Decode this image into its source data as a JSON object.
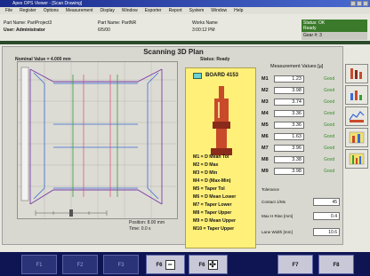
{
  "window": {
    "title": "Apex OPS Viewer - [Scan Drawing]"
  },
  "menu": [
    "File",
    "Register",
    "Options",
    "Measurement",
    "Display",
    "Window",
    "Exporter",
    "Report",
    "System",
    "Window",
    "Help"
  ],
  "info": {
    "r1c1": "Part Name: PartProject3",
    "r1c2": "Part Name: PartNR",
    "r1c3": "Works Name",
    "r2c1": "User: Administrator",
    "r2c2": "6/5/00",
    "r2c3": "3:00:12 PM"
  },
  "status": {
    "top": "Status: OK",
    "sub": "Ready",
    "bottom": "Gear #: 3"
  },
  "panel": {
    "title": "Scanning 3D Plan",
    "meter_left": "Nominal Value = 4.000 mm",
    "meter_right": "Status: Ready",
    "position": "Position: 8.00 mm",
    "time": "Time: 0.0 s"
  },
  "probe": {
    "label": "BOARD 4153",
    "legend": [
      "M1 = D Mean Tol",
      "M2 = D Max",
      "M3 = D Min",
      "M4 = D (Max-Min)",
      "M5 = Taper Tol",
      "M6 = D Mean Lower",
      "M7 = Taper Lower",
      "M8 = Taper Upper",
      "M9 = D Mean Upper",
      "M10 = Taper Upper"
    ]
  },
  "measurement": {
    "title": "Measurement Values [µ]",
    "rows": [
      {
        "key": "M1",
        "value": "1.23",
        "status": "Good"
      },
      {
        "key": "M2",
        "value": "3.98",
        "status": "Good"
      },
      {
        "key": "M3",
        "value": "3.74",
        "status": "Good"
      },
      {
        "key": "M4",
        "value": "3.36",
        "status": "Good"
      },
      {
        "key": "M5",
        "value": "3.36",
        "status": "Good"
      },
      {
        "key": "M6",
        "value": "1.63",
        "status": "Good"
      },
      {
        "key": "M7",
        "value": "3.96",
        "status": "Good"
      },
      {
        "key": "M8",
        "value": "3.38",
        "status": "Good"
      },
      {
        "key": "M9",
        "value": "3.98",
        "status": "Good"
      }
    ],
    "extras": [
      {
        "key": "Tolerance",
        "value": ""
      },
      {
        "key": "Contact 1/Mx",
        "value": "45"
      },
      {
        "key": "Max H Rise [mm]",
        "value": "0.4"
      },
      {
        "key": "Lane Width [mm]",
        "value": "10.6"
      }
    ]
  },
  "toolbar_icons": [
    "ruler-icon",
    "bar-chart-icon",
    "profile-chart-icon",
    "stats-chart-icon",
    "level-chart-icon"
  ],
  "fkeys": [
    {
      "label": "F1",
      "active": false
    },
    {
      "label": "F2",
      "active": false
    },
    {
      "label": "F3",
      "active": false
    },
    {
      "label": "F4",
      "active": false
    },
    {
      "label": "F5",
      "active": false
    },
    {
      "label": "F6",
      "active": true,
      "icon": "−"
    },
    {
      "label": "F6",
      "active": true,
      "icon": "✣"
    },
    {
      "label": "F7",
      "active": true
    },
    {
      "label": "F8",
      "active": true
    }
  ],
  "colors": {
    "accent": "#fff07a",
    "ok": "#3a8a2a",
    "fbar": "#0e1552"
  }
}
